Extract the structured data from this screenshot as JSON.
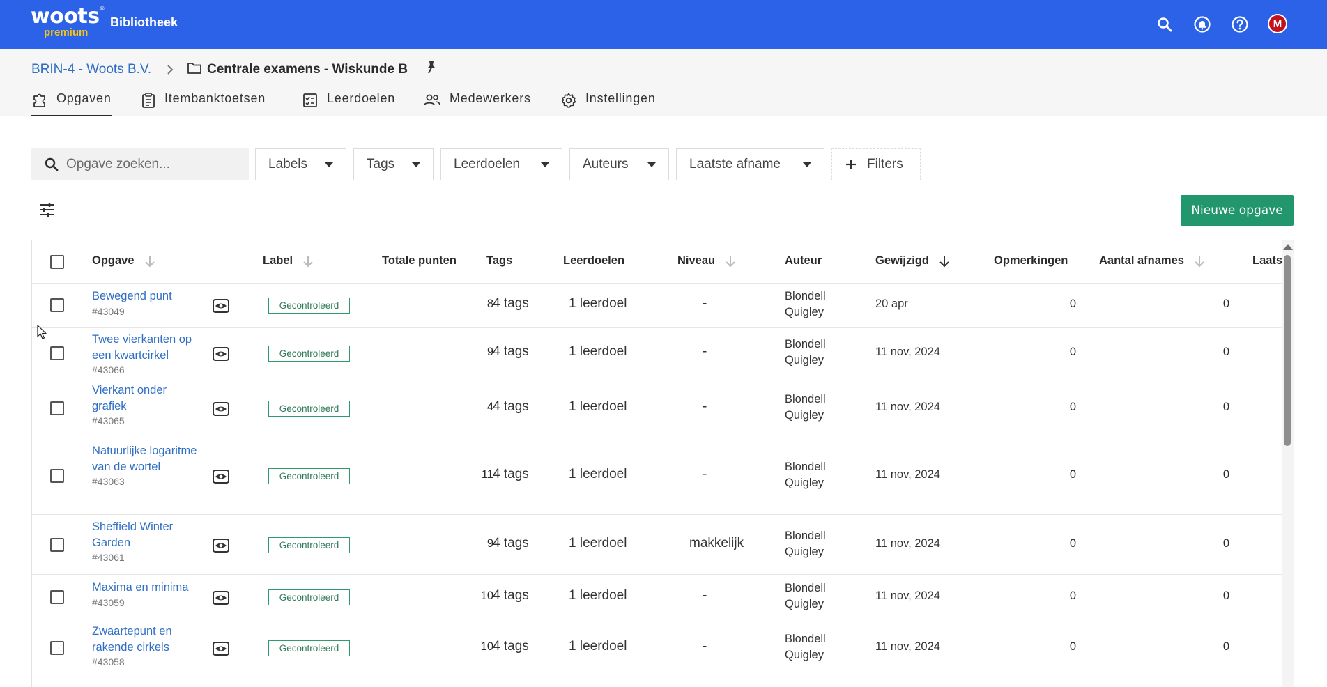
{
  "topbar": {
    "logo_main": "woots",
    "logo_tm": "®",
    "logo_sub": "premium",
    "app_name": "Bibliotheek",
    "avatar_initial": "M",
    "colors": {
      "bar": "#2c62e8",
      "logo_sub": "#f5c518",
      "avatar": "#c1121f"
    }
  },
  "breadcrumb": {
    "parent": "BRIN-4 - Woots B.V.",
    "current": "Centrale examens - Wiskunde B"
  },
  "tabs": [
    {
      "label": "Opgaven",
      "icon": "puzzle-icon",
      "active": true
    },
    {
      "label": "Itembanktoetsen",
      "icon": "clipboard-icon",
      "active": false
    },
    {
      "label": "Leerdoelen",
      "icon": "checklist-icon",
      "active": false
    },
    {
      "label": "Medewerkers",
      "icon": "people-icon",
      "active": false
    },
    {
      "label": "Instellingen",
      "icon": "gear-icon",
      "active": false
    }
  ],
  "search": {
    "placeholder": "Opgave zoeken..."
  },
  "filters": {
    "labels": "Labels",
    "tags": "Tags",
    "leerdoelen": "Leerdoelen",
    "auteurs": "Auteurs",
    "laatste_afname": "Laatste afname",
    "more": "Filters"
  },
  "new_button": "Nieuwe opgave",
  "table": {
    "headers": {
      "opgave": "Opgave",
      "label": "Label",
      "totale_punten": "Totale punten",
      "tags": "Tags",
      "leerdoelen": "Leerdoelen",
      "niveau": "Niveau",
      "auteur": "Auteur",
      "gewijzigd": "Gewijzigd",
      "opmerkingen": "Opmerkingen",
      "aantal_afnames": "Aantal afnames",
      "laatste": "Laats"
    },
    "rows": [
      {
        "title": "Bewegend punt",
        "id": "#43049",
        "label": "Gecontroleerd",
        "punten": "8",
        "tags": "4 tags",
        "leerdoelen": "1 leerdoel",
        "niveau": "-",
        "auteur_first": "Blondell",
        "auteur_last": "Quigley",
        "gewijzigd": "20 apr",
        "opmerkingen": "0",
        "afnames": "0"
      },
      {
        "title": "Twee vierkanten op een kwartcirkel",
        "id": "#43066",
        "label": "Gecontroleerd",
        "punten": "9",
        "tags": "4 tags",
        "leerdoelen": "1 leerdoel",
        "niveau": "-",
        "auteur_first": "Blondell",
        "auteur_last": "Quigley",
        "gewijzigd": "11 nov, 2024",
        "opmerkingen": "0",
        "afnames": "0"
      },
      {
        "title": "Vierkant onder grafiek",
        "id": "#43065",
        "label": "Gecontroleerd",
        "punten": "4",
        "tags": "4 tags",
        "leerdoelen": "1 leerdoel",
        "niveau": "-",
        "auteur_first": "Blondell",
        "auteur_last": "Quigley",
        "gewijzigd": "11 nov, 2024",
        "opmerkingen": "0",
        "afnames": "0"
      },
      {
        "title": "Natuurlijke logaritme van de wortel",
        "id": "#43063",
        "label": "Gecontroleerd",
        "punten": "11",
        "tags": "4 tags",
        "leerdoelen": "1 leerdoel",
        "niveau": "-",
        "auteur_first": "Blondell",
        "auteur_last": "Quigley",
        "gewijzigd": "11 nov, 2024",
        "opmerkingen": "0",
        "afnames": "0"
      },
      {
        "title": "Sheffield Winter Garden",
        "id": "#43061",
        "label": "Gecontroleerd",
        "punten": "9",
        "tags": "4 tags",
        "leerdoelen": "1 leerdoel",
        "niveau": "makkelijk",
        "auteur_first": "Blondell",
        "auteur_last": "Quigley",
        "gewijzigd": "11 nov, 2024",
        "opmerkingen": "0",
        "afnames": "0"
      },
      {
        "title": "Maxima en minima",
        "id": "#43059",
        "label": "Gecontroleerd",
        "punten": "10",
        "tags": "4 tags",
        "leerdoelen": "1 leerdoel",
        "niveau": "-",
        "auteur_first": "Blondell",
        "auteur_last": "Quigley",
        "gewijzigd": "11 nov, 2024",
        "opmerkingen": "0",
        "afnames": "0"
      },
      {
        "title": "Zwaartepunt en rakende cirkels",
        "id": "#43058",
        "label": "Gecontroleerd",
        "punten": "10",
        "tags": "4 tags",
        "leerdoelen": "1 leerdoel",
        "niveau": "-",
        "auteur_first": "Blondell",
        "auteur_last": "Quigley",
        "gewijzigd": "11 nov, 2024",
        "opmerkingen": "0",
        "afnames": "0"
      }
    ]
  },
  "accent_colors": {
    "link": "#2f6ec4",
    "primary_button": "#22976e",
    "badge": "#2e9b6e"
  }
}
